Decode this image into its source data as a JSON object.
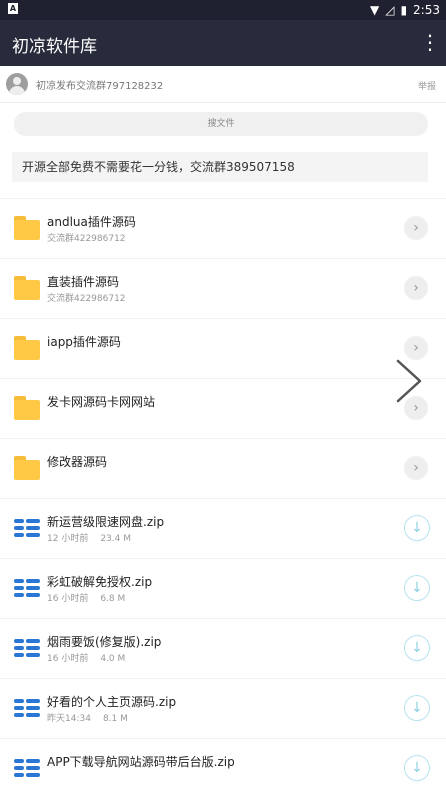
{
  "status_bar": {
    "time": "2:53"
  },
  "appbar": {
    "title": "初凉软件库",
    "menu_icon": "more-vertical-icon"
  },
  "group_bar": {
    "text": "初凉发布交流群797128232",
    "report": "举报"
  },
  "search": {
    "placeholder": "搜文件"
  },
  "notice": {
    "text": "开源全部免费不需要花一分钱，交流群389507158"
  },
  "folders": [
    {
      "name": "andlua插件源码",
      "sub": "交流群422986712"
    },
    {
      "name": "直装插件源码",
      "sub": "交流群422986712"
    },
    {
      "name": "iapp插件源码",
      "sub": ""
    },
    {
      "name": "发卡网源码卡网网站",
      "sub": ""
    },
    {
      "name": "修改器源码",
      "sub": ""
    }
  ],
  "files": [
    {
      "name": "新运营级限速网盘.zip",
      "time": "12 小时前",
      "size": "23.4 M"
    },
    {
      "name": "彩虹破解免授权.zip",
      "time": "16 小时前",
      "size": "6.8 M"
    },
    {
      "name": "烟雨要饭(修复版).zip",
      "time": "16 小时前",
      "size": "4.0 M"
    },
    {
      "name": "好看的个人主页源码.zip",
      "time": "昨天14:34",
      "size": "8.1 M"
    },
    {
      "name": "APP下载导航网站源码带后台版.zip",
      "time": "",
      "size": ""
    }
  ]
}
